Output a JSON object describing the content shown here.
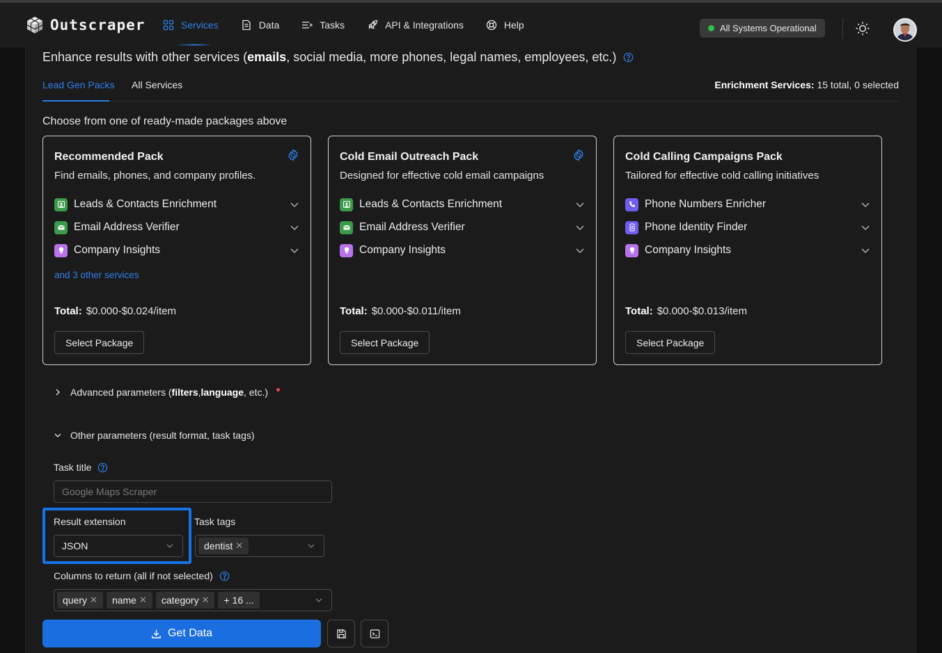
{
  "brand": {
    "name": "Outscraper"
  },
  "nav": {
    "items": [
      {
        "label": "Services",
        "icon": "grid-icon",
        "active": true
      },
      {
        "label": "Data",
        "icon": "document-icon"
      },
      {
        "label": "Tasks",
        "icon": "list-icon"
      },
      {
        "label": "API & Integrations",
        "icon": "rocket-icon"
      },
      {
        "label": "Help",
        "icon": "lifebuoy-icon"
      }
    ]
  },
  "status": {
    "label": "All Systems Operational",
    "color": "#2fbf4a"
  },
  "enhance": {
    "prefix": "Enhance results with other services (",
    "bold": "emails",
    "suffix": ", social media, more phones, legal names, employees, etc.)"
  },
  "tabs": [
    {
      "label": "Lead Gen Packs",
      "active": true
    },
    {
      "label": "All Services"
    }
  ],
  "enrichment_summary": {
    "label": "Enrichment Services:",
    "value": "15 total, 0 selected"
  },
  "choose_text": "Choose from one of ready-made packages above",
  "packs": [
    {
      "title": "Recommended Pack",
      "description": "Find emails, phones, and company profiles.",
      "services": [
        {
          "label": "Leads & Contacts Enrichment",
          "icon": "contacts-enrichment-icon",
          "color": "#3a9a4a"
        },
        {
          "label": "Email Address Verifier",
          "icon": "email-verifier-icon",
          "color": "#3a9a4a"
        },
        {
          "label": "Company Insights",
          "icon": "lightbulb-icon",
          "color": "#b873e8"
        }
      ],
      "more": "and 3 other services",
      "total_label": "Total:",
      "total_value": "$0.000-$0.024/item",
      "button": "Select Package"
    },
    {
      "title": "Cold Email Outreach Pack",
      "description": "Designed for effective cold email campaigns",
      "services": [
        {
          "label": "Leads & Contacts Enrichment",
          "icon": "contacts-enrichment-icon",
          "color": "#3a9a4a"
        },
        {
          "label": "Email Address Verifier",
          "icon": "email-verifier-icon",
          "color": "#3a9a4a"
        },
        {
          "label": "Company Insights",
          "icon": "lightbulb-icon",
          "color": "#b873e8"
        }
      ],
      "total_label": "Total:",
      "total_value": "$0.000-$0.011/item",
      "button": "Select Package"
    },
    {
      "title": "Cold Calling Campaigns Pack",
      "description": "Tailored for effective cold calling initiatives",
      "services": [
        {
          "label": "Phone Numbers Enricher",
          "icon": "phone-icon",
          "color": "#6f5cf0"
        },
        {
          "label": "Phone Identity Finder",
          "icon": "phone-id-icon",
          "color": "#6f5cf0"
        },
        {
          "label": "Company Insights",
          "icon": "lightbulb-icon",
          "color": "#b873e8"
        }
      ],
      "total_label": "Total:",
      "total_value": "$0.000-$0.013/item",
      "button": "Select Package"
    }
  ],
  "advanced": {
    "prefix": "Advanced parameters (",
    "bold1": "filters",
    "sep": ", ",
    "bold2": "language",
    "suffix": ", etc.)"
  },
  "other_params": {
    "label": "Other parameters (result format, task tags)"
  },
  "task_title": {
    "label": "Task title",
    "placeholder": "Google Maps Scraper",
    "value": ""
  },
  "result_extension": {
    "label": "Result extension",
    "value": "JSON"
  },
  "task_tags": {
    "label": "Task tags",
    "tags": [
      "dentist"
    ]
  },
  "columns": {
    "label": "Columns to return (all if not selected)",
    "tags": [
      "query",
      "name",
      "category"
    ],
    "more": "+ 16 ..."
  },
  "actions": {
    "get_data": "Get Data"
  },
  "colors": {
    "accent": "#2f7fe8",
    "primary_button": "#1b6ee0",
    "highlight": "#1573e6"
  }
}
